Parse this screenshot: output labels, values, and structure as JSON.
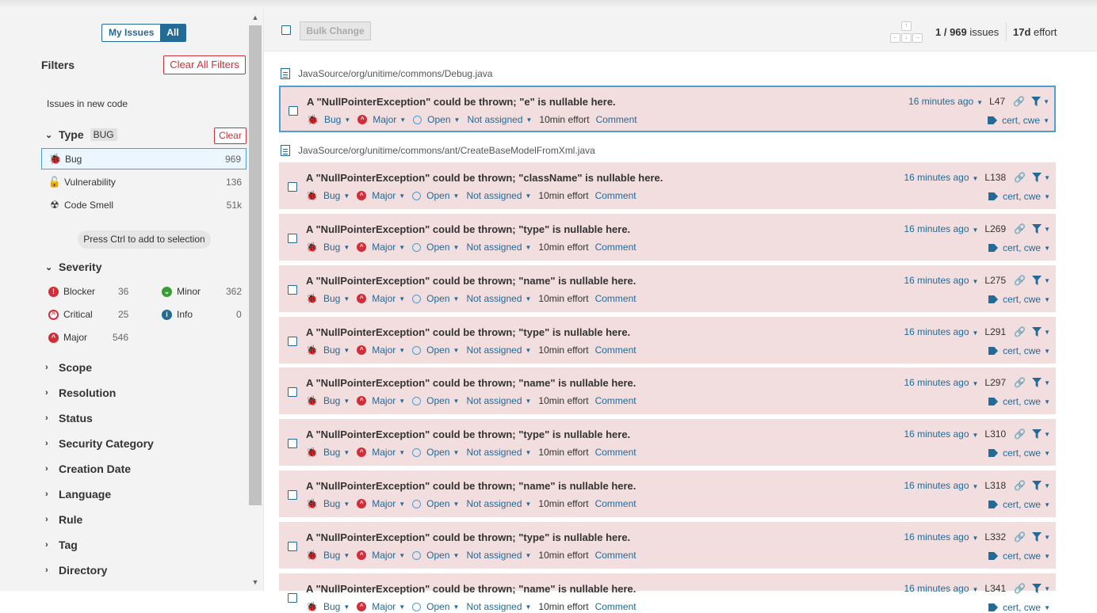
{
  "sidebar": {
    "toggle": {
      "my": "My Issues",
      "all": "All"
    },
    "filters_title": "Filters",
    "clear_all": "Clear All Filters",
    "new_code": "Issues in new code",
    "type_facet": {
      "title": "Type",
      "badge": "BUG",
      "clear": "Clear"
    },
    "types": [
      {
        "label": "Bug",
        "count": "969"
      },
      {
        "label": "Vulnerability",
        "count": "136"
      },
      {
        "label": "Code Smell",
        "count": "51k"
      }
    ],
    "press_ctrl": "Press Ctrl to add to selection",
    "severity_title": "Severity",
    "severities": [
      {
        "label": "Blocker",
        "count": "36"
      },
      {
        "label": "Minor",
        "count": "362"
      },
      {
        "label": "Critical",
        "count": "25"
      },
      {
        "label": "Info",
        "count": "0"
      },
      {
        "label": "Major",
        "count": "546"
      }
    ],
    "facets": [
      "Scope",
      "Resolution",
      "Status",
      "Security Category",
      "Creation Date",
      "Language",
      "Rule",
      "Tag",
      "Directory"
    ]
  },
  "topbar": {
    "bulk_change": "Bulk Change",
    "count_num": "1 / 969",
    "count_label": " issues",
    "effort_num": "17d",
    "effort_label": " effort"
  },
  "files": [
    "JavaSource/org/unitime/commons/Debug.java",
    "JavaSource/org/unitime/commons/ant/CreateBaseModelFromXml.java"
  ],
  "issue_common": {
    "type": "Bug",
    "severity": "Major",
    "status": "Open",
    "assignee": "Not assigned",
    "effort": "10min effort",
    "comment": "Comment",
    "time": "16 minutes ago",
    "tags": "cert, cwe"
  },
  "issues": [
    {
      "msg": "A \"NullPointerException\" could be thrown; \"e\" is nullable here.",
      "line": "L47"
    },
    {
      "msg": "A \"NullPointerException\" could be thrown; \"className\" is nullable here.",
      "line": "L138"
    },
    {
      "msg": "A \"NullPointerException\" could be thrown; \"type\" is nullable here.",
      "line": "L269"
    },
    {
      "msg": "A \"NullPointerException\" could be thrown; \"name\" is nullable here.",
      "line": "L275"
    },
    {
      "msg": "A \"NullPointerException\" could be thrown; \"type\" is nullable here.",
      "line": "L291"
    },
    {
      "msg": "A \"NullPointerException\" could be thrown; \"name\" is nullable here.",
      "line": "L297"
    },
    {
      "msg": "A \"NullPointerException\" could be thrown; \"type\" is nullable here.",
      "line": "L310"
    },
    {
      "msg": "A \"NullPointerException\" could be thrown; \"name\" is nullable here.",
      "line": "L318"
    },
    {
      "msg": "A \"NullPointerException\" could be thrown; \"type\" is nullable here.",
      "line": "L332"
    },
    {
      "msg": "A \"NullPointerException\" could be thrown; \"name\" is nullable here.",
      "line": "L341"
    }
  ],
  "colors": {
    "accent": "#236a97",
    "issue_bg": "#f2dede",
    "danger": "#d02f3a"
  }
}
